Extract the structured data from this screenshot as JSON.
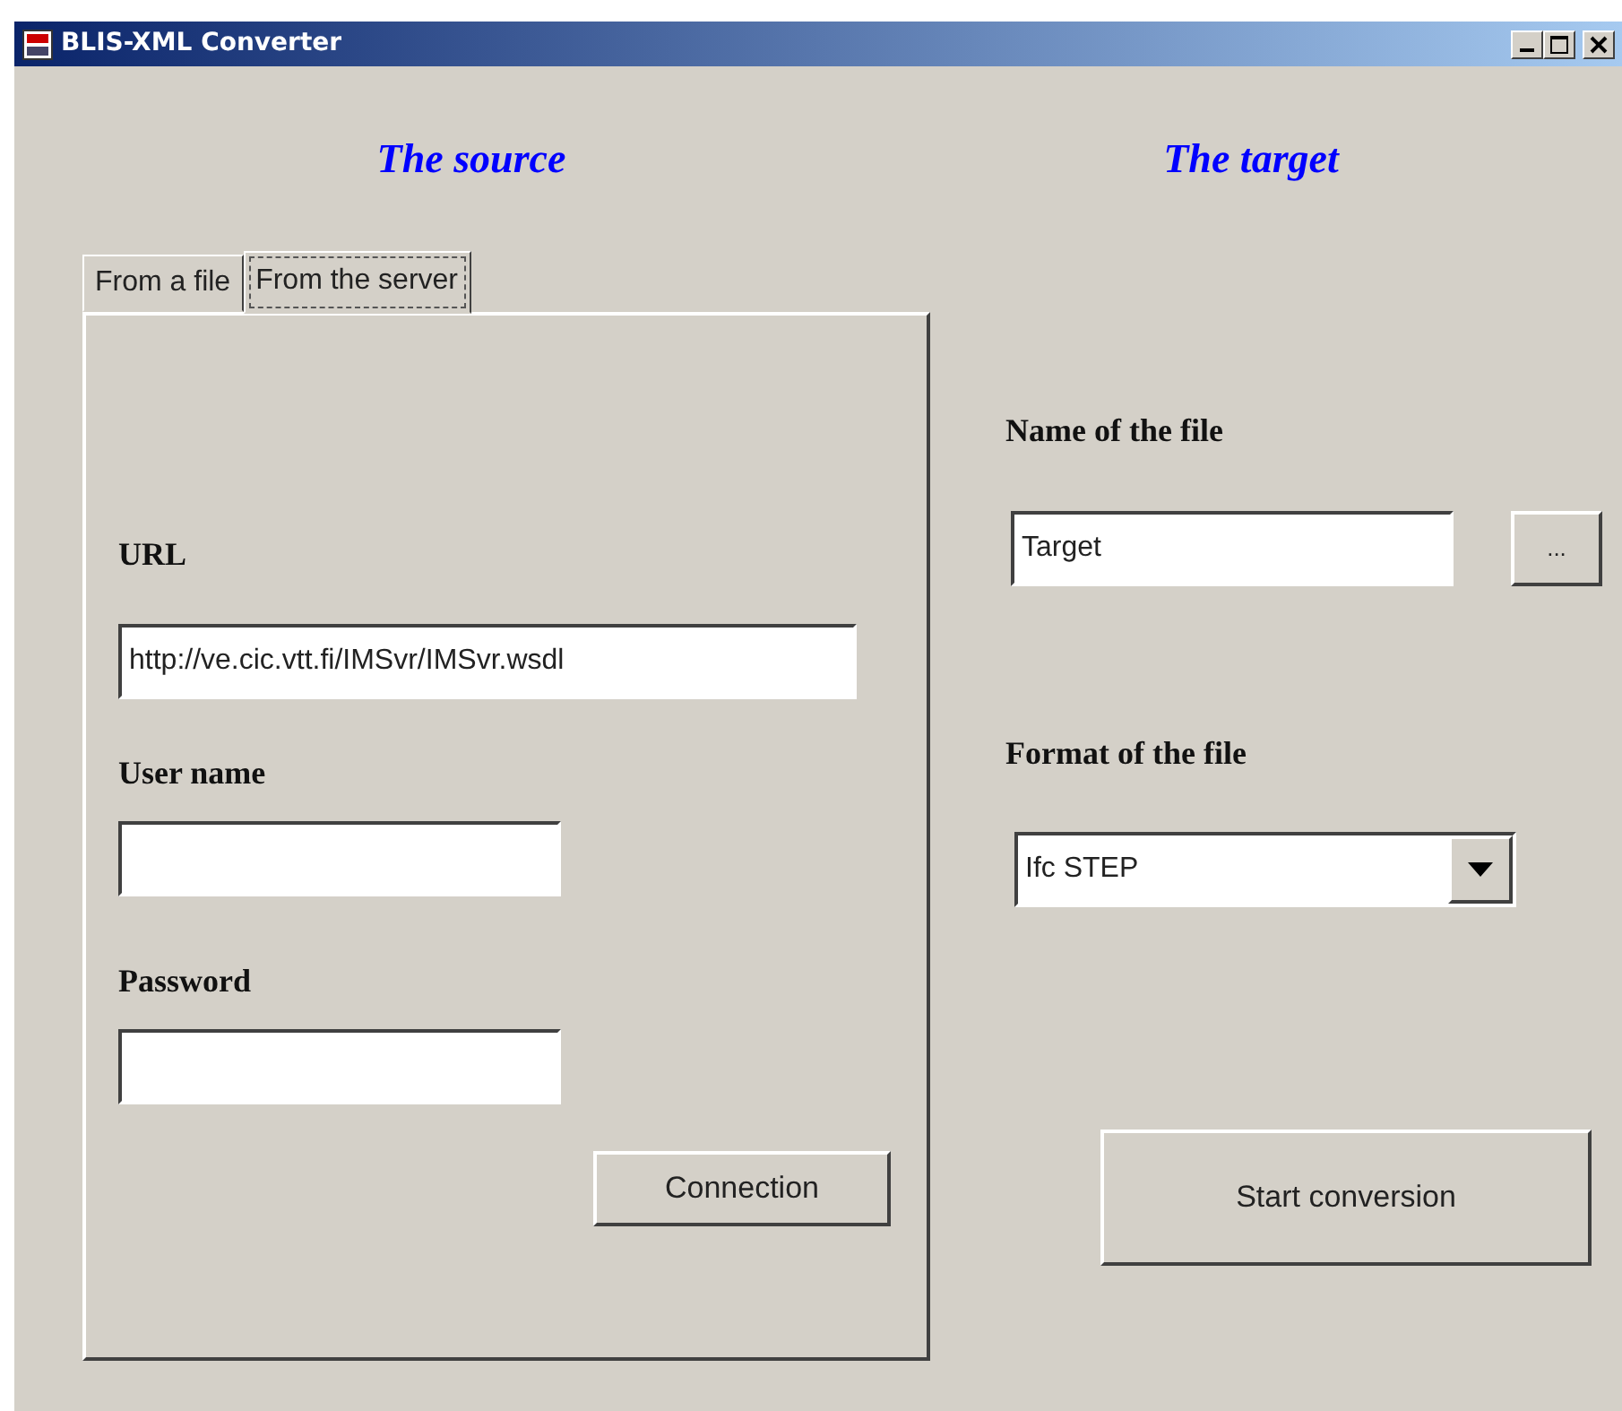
{
  "window": {
    "title": "BLIS-XML Converter"
  },
  "source": {
    "heading": "The source",
    "tabs": [
      {
        "label": "From a file",
        "selected": false
      },
      {
        "label": "From the server",
        "selected": true
      }
    ],
    "fields": [
      {
        "label": "URL",
        "value": "http://ve.cic.vtt.fi/IMSvr/IMSvr.wsdl"
      },
      {
        "label": "User name"
      },
      {
        "label": "Password"
      }
    ],
    "button": "Connection"
  },
  "target": {
    "heading": "The target",
    "name_label": "Name of the file",
    "name_value": "Target",
    "browse_button": "...",
    "format_label": "Format of the file",
    "format_value": "Ifc STEP",
    "button": "Start conversion"
  }
}
